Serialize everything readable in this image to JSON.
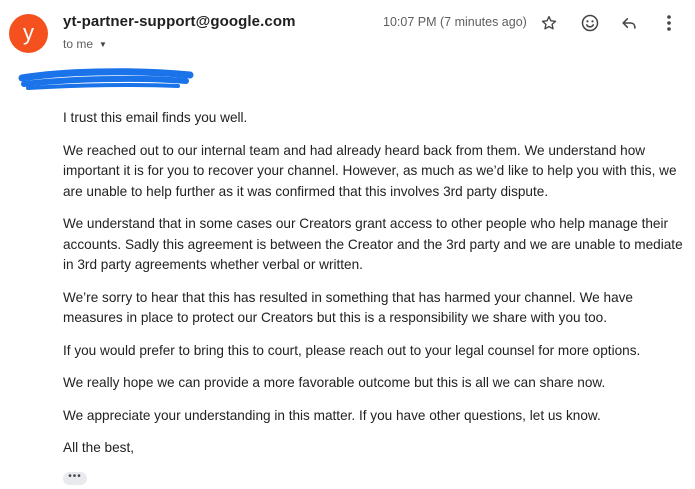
{
  "header": {
    "avatar_letter": "y",
    "avatar_color": "#f4511e",
    "sender": "yt-partner-support@google.com",
    "recipient": "to me",
    "time": "10:07 PM (7 minutes ago)",
    "icons": [
      "star-icon",
      "emoji-icon",
      "reply-icon",
      "more-vert-icon"
    ]
  },
  "redaction_color": "#1a73e8",
  "body": {
    "paragraphs": [
      "I trust this email finds you well.",
      "We reached out to our internal team and had already heard back from them. We understand how important it is for you to recover your channel. However, as much as we’d like to help you with this, we are unable to help further as it was confirmed that this involves 3rd party dispute.",
      "We understand that in some cases our Creators grant access to other people who help manage their accounts. Sadly this agreement is between the Creator and the 3rd party and we are unable to mediate in 3rd party agreements whether verbal or written.",
      "We’re sorry to hear that this has resulted in something that has harmed your channel. We have measures in place to protect our Creators but this is a responsibility we share with you too.",
      "If you would prefer to bring this to court, please reach out to your legal counsel for more options.",
      "We really hope we can provide a more favorable outcome but this is all we can share now.",
      "We appreciate your understanding in this matter. If you have other questions, let us know.",
      "All the best,"
    ],
    "show_trimmed_label": "•••"
  }
}
